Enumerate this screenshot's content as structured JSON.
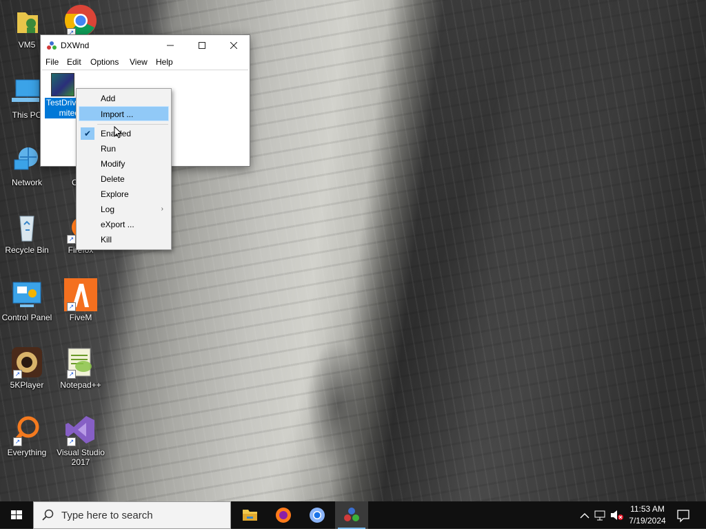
{
  "desktop": {
    "icons": [
      {
        "label": "VM5"
      },
      {
        "label": ""
      },
      {
        "label": "This PC"
      },
      {
        "label": "Network"
      },
      {
        "label": "Chro"
      },
      {
        "label": "Recycle Bin"
      },
      {
        "label": "Firefox"
      },
      {
        "label": "Control Panel"
      },
      {
        "label": "FiveM"
      },
      {
        "label": "5KPlayer"
      },
      {
        "label": "Notepad++"
      },
      {
        "label": "Everything"
      },
      {
        "label": "Visual Studio 2017"
      }
    ]
  },
  "window": {
    "title": "DXWnd",
    "menu": [
      "File",
      "Edit",
      "Options",
      "View",
      "Help"
    ],
    "item_label_line1": "TestDrive",
    "item_label_line2": "mited"
  },
  "context_menu": {
    "items": [
      "Add",
      "Import ...",
      "Enabled",
      "Run",
      "Modify",
      "Delete",
      "Explore",
      "Log",
      "eXport ...",
      "Kill"
    ],
    "highlighted": "Import ...",
    "checked": "Enabled"
  },
  "taskbar": {
    "search_placeholder": "Type here to search",
    "time": "11:53 AM",
    "date": "7/19/2024"
  },
  "colors": {
    "selection": "#0078d7",
    "menu_highlight": "#91c9f7",
    "taskbar": "#101010"
  }
}
